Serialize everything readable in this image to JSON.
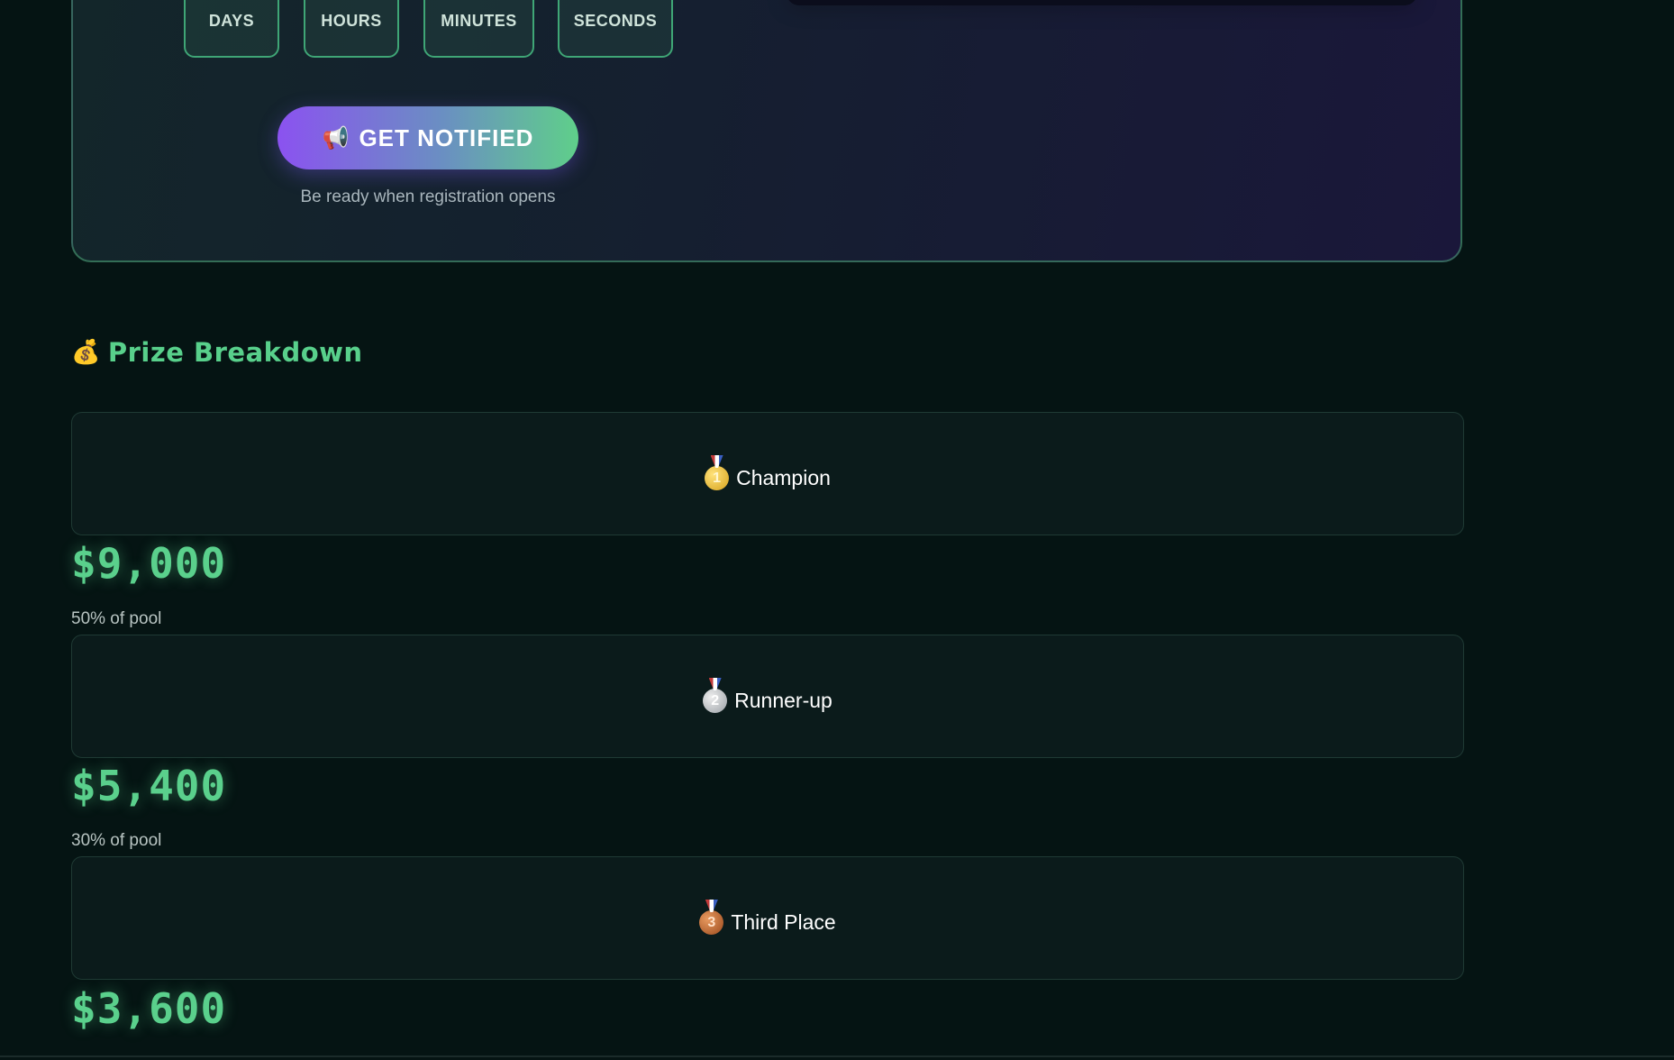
{
  "countdown": {
    "labels": [
      "DAYS",
      "HOURS",
      "MINUTES",
      "SECONDS"
    ]
  },
  "notify": {
    "icon": "megaphone-icon",
    "label": "GET NOTIFIED",
    "subtext": "Be ready when registration opens"
  },
  "prizes": {
    "title_icon": "money-bag-icon",
    "title": "Prize Breakdown",
    "items": [
      {
        "place": "Champion",
        "medal": "gold-medal-icon",
        "number": "1",
        "amount": "$9,000",
        "share": "50% of pool"
      },
      {
        "place": "Runner-up",
        "medal": "silver-medal-icon",
        "number": "2",
        "amount": "$5,400",
        "share": "30% of pool"
      },
      {
        "place": "Third Place",
        "medal": "bronze-medal-icon",
        "number": "3",
        "amount": "$3,600",
        "share": ""
      }
    ]
  },
  "colors": {
    "background": "#051413",
    "accent_green": "#58d08b",
    "accent_purple": "#8b52f0"
  }
}
